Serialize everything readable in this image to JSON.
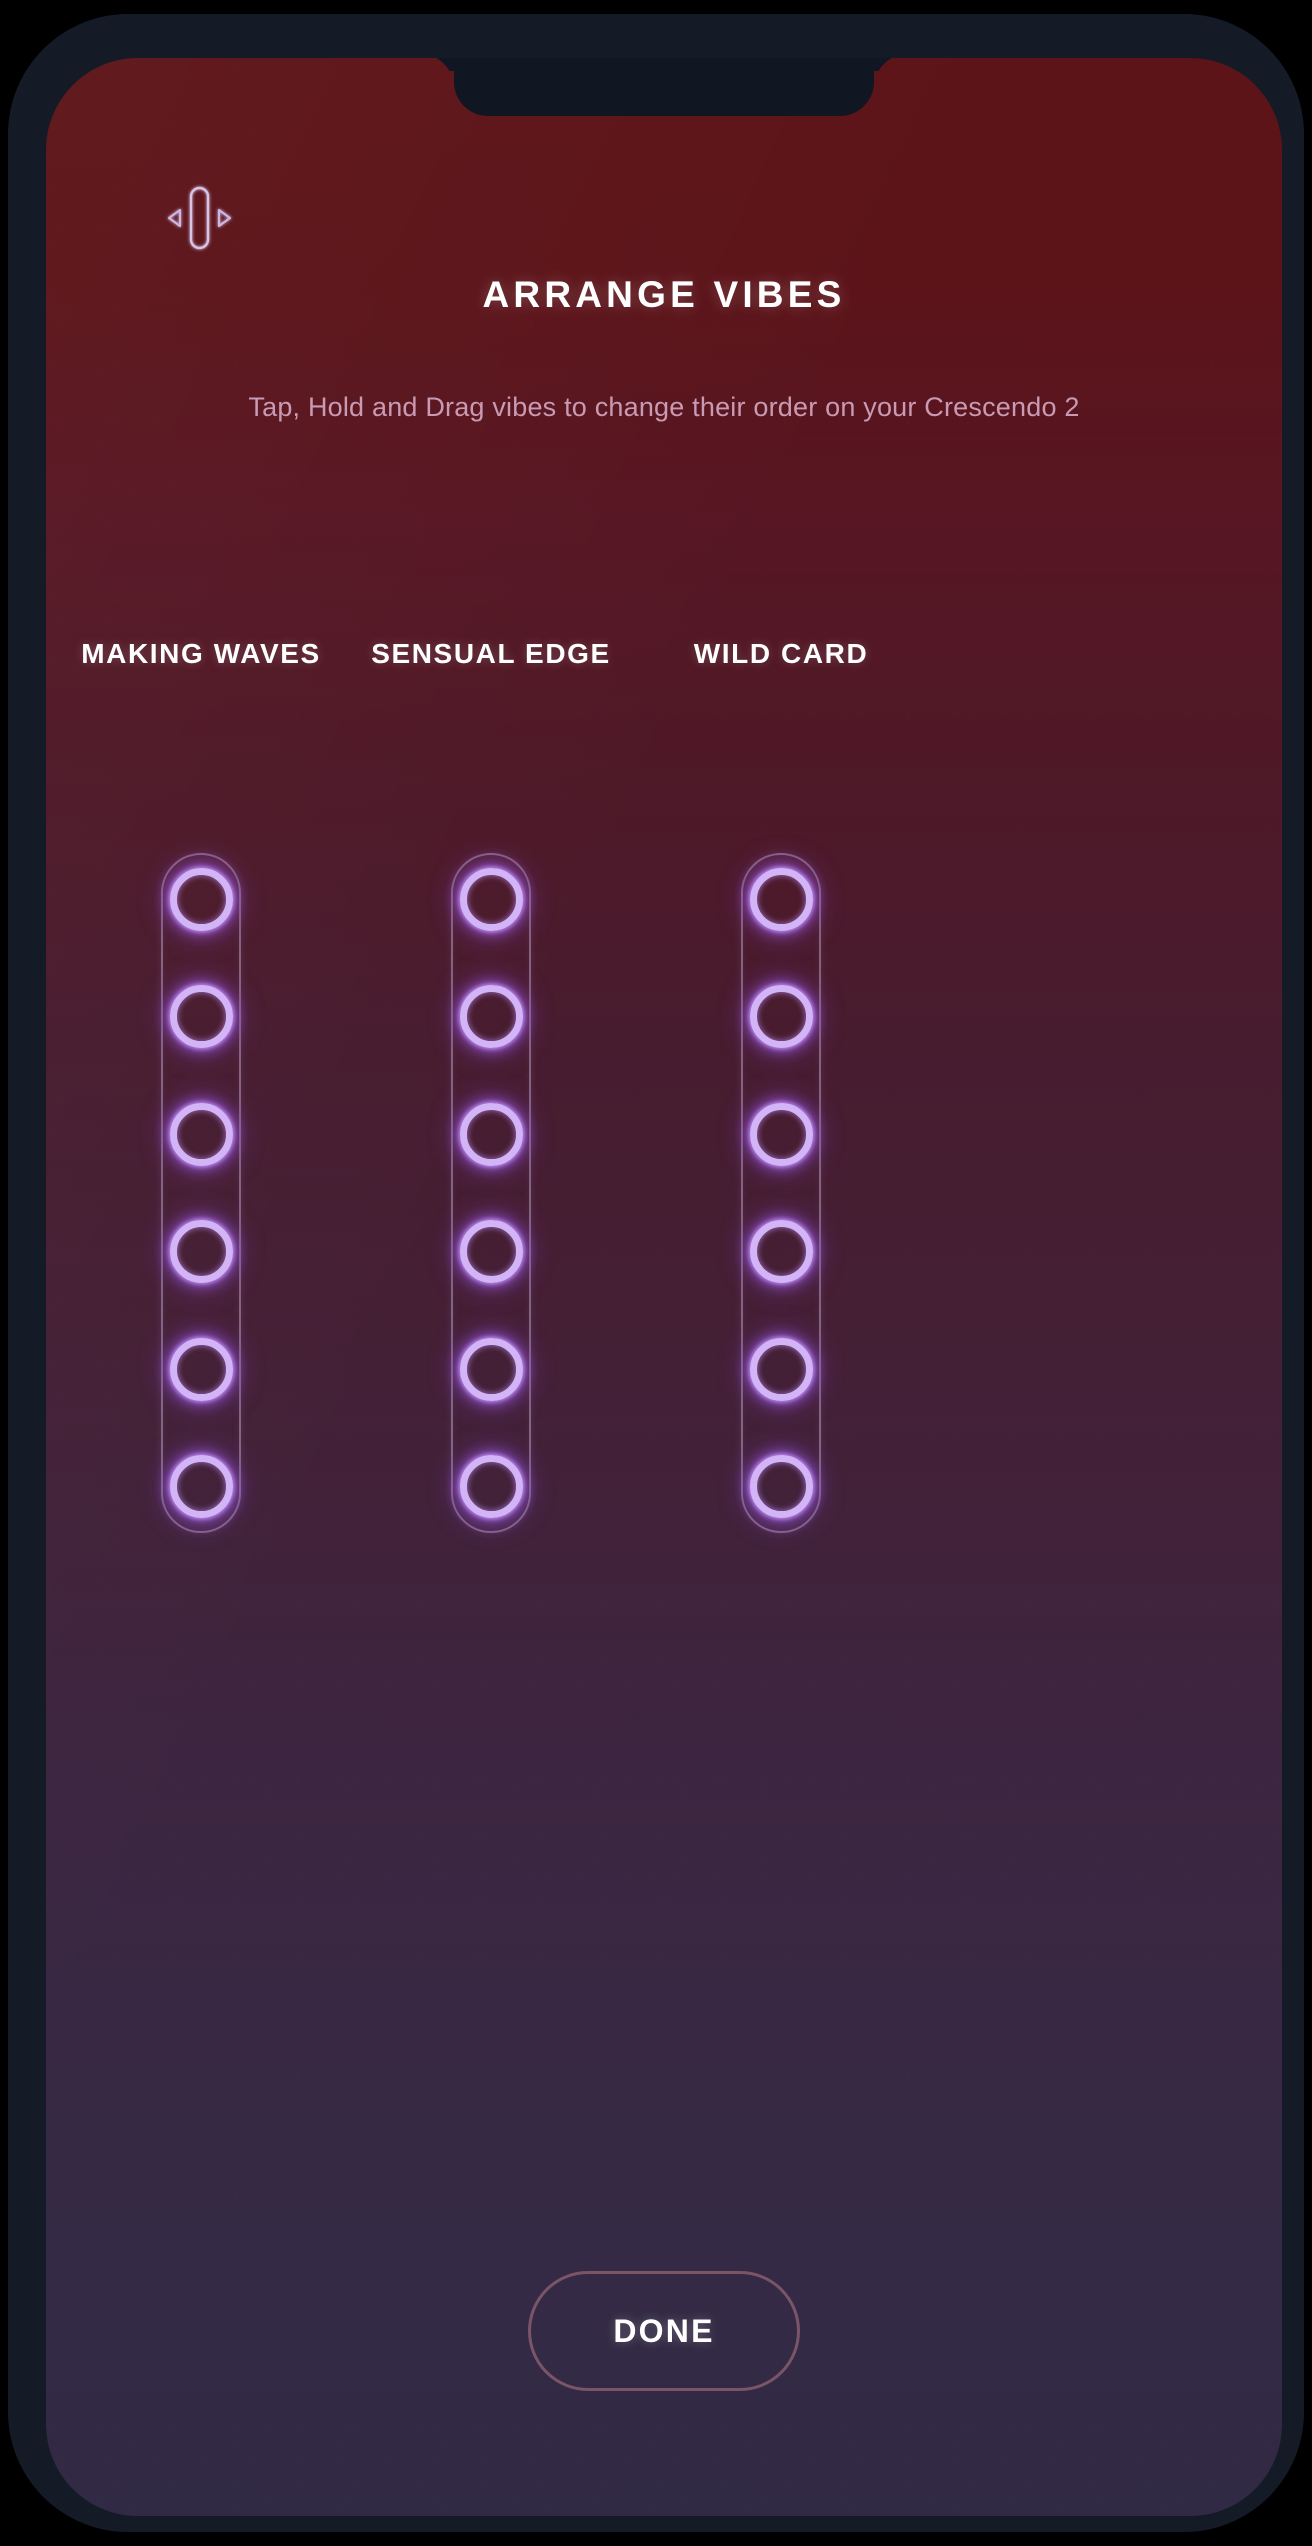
{
  "screen": {
    "title": "ARRANGE VIBES",
    "subtitle": "Tap, Hold and Drag vibes to change their order on your Crescendo 2",
    "drag_handle_icon": "drag-horizontal-handle-icon",
    "colors": {
      "background_top": "#5d1418",
      "background_bottom": "#312a45",
      "device_frame": "#141b26",
      "notch": "#111722",
      "title_text": "#ffffff",
      "subtitle_text": "#c99ab3",
      "vibe_dot_glow": "#d3b4f7",
      "vibe_track_border": "#ceb6de",
      "done_border": "#7b5468"
    }
  },
  "vibe_columns": [
    {
      "label": "MAKING WAVES",
      "dot_count": 6
    },
    {
      "label": "SENSUAL EDGE",
      "dot_count": 6
    },
    {
      "label": "WILD CARD",
      "dot_count": 6
    }
  ],
  "footer": {
    "done_label": "DONE"
  }
}
